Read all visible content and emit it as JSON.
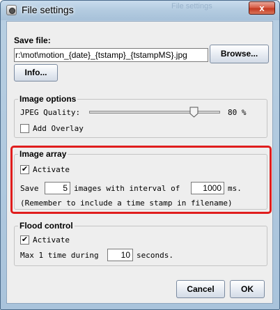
{
  "window": {
    "title": "File settings",
    "close_glyph": "x",
    "close_icon": "close-icon",
    "app_icon": "camera-icon",
    "ghost_text": "File settings"
  },
  "save_file": {
    "label": "Save file:",
    "path_value": "r:\\mot\\motion_{date}_{tstamp}_{tstampMS}.jpg",
    "browse_label": "Browse...",
    "info_label": "Info..."
  },
  "image_options": {
    "legend": "Image options",
    "jpeg_quality_label": "JPEG Quality:",
    "jpeg_quality": 80,
    "jpeg_quality_text": "80 %",
    "add_overlay_label": "Add Overlay",
    "add_overlay_checked": false
  },
  "image_array": {
    "legend": "Image array",
    "activate_label": "Activate",
    "activate_checked": true,
    "save_label": "Save",
    "image_count": "5",
    "images_with_interval_label": "images with interval of",
    "interval_value": "1000",
    "ms_label": "ms.",
    "reminder": "(Remember to include a time stamp in filename)",
    "highlight_color": "#e01d1d"
  },
  "flood_control": {
    "legend": "Flood control",
    "activate_label": "Activate",
    "activate_checked": true,
    "max_label": "Max 1 time during",
    "seconds_value": "10",
    "seconds_label": "seconds."
  },
  "footer": {
    "cancel_label": "Cancel",
    "ok_label": "OK"
  },
  "check_glyph": "✔"
}
